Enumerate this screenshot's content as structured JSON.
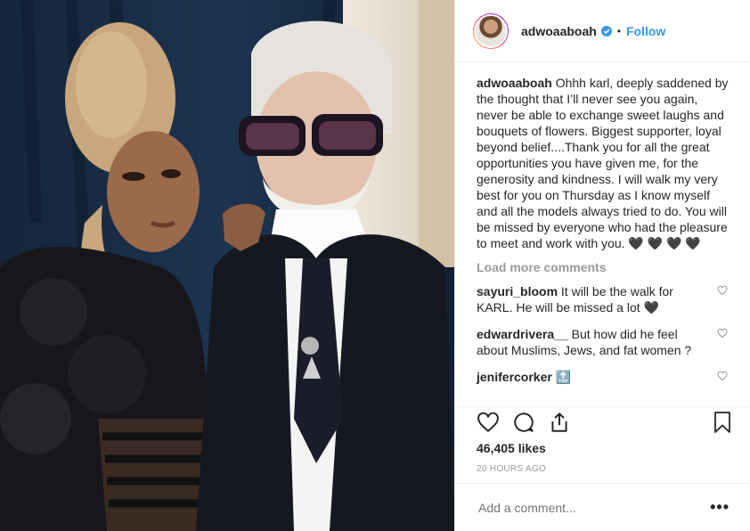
{
  "header": {
    "username": "adwoaaboah",
    "follow_label": "Follow",
    "separator": "•"
  },
  "caption": {
    "username": "adwoaaboah",
    "text": "Ohhh karl, deeply saddened by the thought that I’ll never see you again, never be able to exchange sweet laughs and bouquets of flowers. Biggest supporter, loyal beyond belief....Thank you for all the great opportunities you have given me, for the generosity and kindness. I will walk my very best for you on Thursday as I know myself and all the models always tried to do. You will be missed by everyone who had the pleasure to meet and work with you. 🖤 🖤 🖤 🖤"
  },
  "load_more": "Load more comments",
  "comments": [
    {
      "username": "sayuri_bloom",
      "text": "It will be the walk for KARL. He will be missed a lot 🖤"
    },
    {
      "username": "edwardrivera__",
      "text": "But how did he feel about Muslims, Jews, and fat women ?"
    },
    {
      "username": "jenifercorker",
      "text": "🔝"
    }
  ],
  "actions": {
    "likes": "46,405 likes",
    "timestamp": "20 HOURS AGO",
    "comment_placeholder": "Add a comment...",
    "more_label": "•••"
  },
  "colors": {
    "link": "#3897f0",
    "muted": "#999999",
    "text": "#262626"
  }
}
